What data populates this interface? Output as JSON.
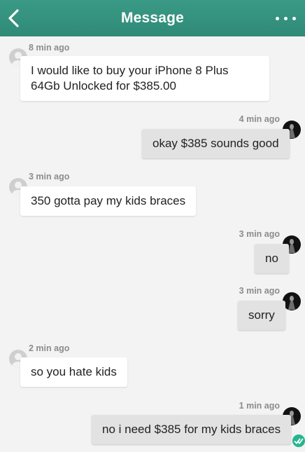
{
  "header": {
    "title": "Message",
    "back_icon": "chevron-left-icon",
    "more_icon": "more-horizontal-icon"
  },
  "colors": {
    "header": "#3a9a86",
    "incoming_bubble": "#ffffff",
    "outgoing_bubble": "#e2e2e2",
    "timestamp": "#8c8c8c",
    "read_check": "#27b58e"
  },
  "messages": [
    {
      "direction": "incoming",
      "time": "8 min ago",
      "text": "I would like to buy your iPhone 8 Plus 64Gb Unlocked for $385.00"
    },
    {
      "direction": "outgoing",
      "time": "4 min ago",
      "text": "okay $385 sounds good"
    },
    {
      "direction": "incoming",
      "time": "3 min ago",
      "text": "350 gotta pay my kids braces"
    },
    {
      "direction": "outgoing",
      "time": "3 min ago",
      "text": "no"
    },
    {
      "direction": "outgoing",
      "time": "3 min ago",
      "text": "sorry"
    },
    {
      "direction": "incoming",
      "time": "2 min ago",
      "text": "so you hate kids"
    },
    {
      "direction": "outgoing",
      "time": "1 min ago",
      "text": "no i need $385 for my kids braces"
    }
  ],
  "status": {
    "read_icon": "double-check-icon"
  }
}
